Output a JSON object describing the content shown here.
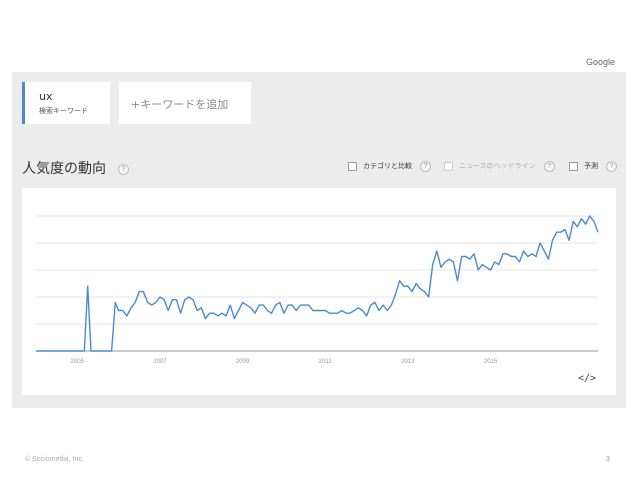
{
  "header": {
    "brand": "Google"
  },
  "keyword": {
    "term": "ux",
    "subtitle": "検索キーワード"
  },
  "add_keyword": {
    "label": "+キーワードを追加"
  },
  "section": {
    "title": "人気度の動向",
    "help": "?"
  },
  "options": [
    {
      "label": "カテゴリと比較",
      "enabled": true
    },
    {
      "label": "ニュースのヘッドライン",
      "enabled": false
    },
    {
      "label": "予測",
      "enabled": true
    }
  ],
  "chart_data": {
    "type": "line",
    "x_ticks": [
      "2005",
      "2007",
      "2009",
      "2011",
      "2013",
      "2015"
    ],
    "ylim": [
      0,
      100
    ],
    "grid": true,
    "color": "#4a8bd0",
    "series": [
      {
        "values": [
          [
            2004.0,
            0
          ],
          [
            2005.17,
            0
          ],
          [
            2005.25,
            24
          ],
          [
            2005.33,
            0
          ],
          [
            2005.83,
            0
          ],
          [
            2005.92,
            18
          ],
          [
            2006.0,
            15
          ],
          [
            2006.1,
            15
          ],
          [
            2006.2,
            13
          ],
          [
            2006.3,
            16
          ],
          [
            2006.4,
            18
          ],
          [
            2006.5,
            22
          ],
          [
            2006.6,
            22
          ],
          [
            2006.7,
            18
          ],
          [
            2006.8,
            17
          ],
          [
            2006.9,
            18
          ],
          [
            2007.0,
            20
          ],
          [
            2007.1,
            19
          ],
          [
            2007.2,
            15
          ],
          [
            2007.3,
            19
          ],
          [
            2007.4,
            19
          ],
          [
            2007.5,
            14
          ],
          [
            2007.6,
            19
          ],
          [
            2007.7,
            20
          ],
          [
            2007.8,
            19
          ],
          [
            2007.9,
            15
          ],
          [
            2008.0,
            16
          ],
          [
            2008.1,
            12
          ],
          [
            2008.2,
            14
          ],
          [
            2008.3,
            14
          ],
          [
            2008.4,
            13
          ],
          [
            2008.5,
            14
          ],
          [
            2008.6,
            13
          ],
          [
            2008.7,
            17
          ],
          [
            2008.8,
            12
          ],
          [
            2008.9,
            15
          ],
          [
            2009.0,
            18
          ],
          [
            2009.1,
            17
          ],
          [
            2009.2,
            16
          ],
          [
            2009.3,
            14
          ],
          [
            2009.4,
            17
          ],
          [
            2009.5,
            17
          ],
          [
            2009.6,
            15
          ],
          [
            2009.7,
            14
          ],
          [
            2009.8,
            17
          ],
          [
            2009.9,
            18
          ],
          [
            2010.0,
            14
          ],
          [
            2010.1,
            17
          ],
          [
            2010.2,
            17
          ],
          [
            2010.3,
            15
          ],
          [
            2010.4,
            17
          ],
          [
            2010.5,
            17
          ],
          [
            2010.6,
            17
          ],
          [
            2010.7,
            15
          ],
          [
            2010.8,
            15
          ],
          [
            2010.9,
            15
          ],
          [
            2011.0,
            15
          ],
          [
            2011.1,
            14
          ],
          [
            2011.2,
            14
          ],
          [
            2011.3,
            14
          ],
          [
            2011.4,
            15
          ],
          [
            2011.5,
            14
          ],
          [
            2011.6,
            14
          ],
          [
            2011.7,
            15
          ],
          [
            2011.8,
            16
          ],
          [
            2011.9,
            15
          ],
          [
            2012.0,
            13
          ],
          [
            2012.1,
            17
          ],
          [
            2012.2,
            18
          ],
          [
            2012.3,
            15
          ],
          [
            2012.4,
            17
          ],
          [
            2012.5,
            15
          ],
          [
            2012.6,
            17
          ],
          [
            2012.7,
            21
          ],
          [
            2012.8,
            26
          ],
          [
            2012.9,
            24
          ],
          [
            2013.0,
            24
          ],
          [
            2013.1,
            22
          ],
          [
            2013.2,
            25
          ],
          [
            2013.3,
            23
          ],
          [
            2013.4,
            22
          ],
          [
            2013.5,
            20
          ],
          [
            2013.6,
            32
          ],
          [
            2013.7,
            37
          ],
          [
            2013.8,
            31
          ],
          [
            2013.9,
            33
          ],
          [
            2014.0,
            34
          ],
          [
            2014.1,
            33
          ],
          [
            2014.2,
            26
          ],
          [
            2014.3,
            35
          ],
          [
            2014.4,
            35
          ],
          [
            2014.5,
            34
          ],
          [
            2014.6,
            36
          ],
          [
            2014.7,
            30
          ],
          [
            2014.8,
            32
          ],
          [
            2014.9,
            31
          ],
          [
            2015.0,
            30
          ],
          [
            2015.1,
            33
          ],
          [
            2015.2,
            32
          ],
          [
            2015.3,
            36
          ],
          [
            2015.4,
            36
          ],
          [
            2015.5,
            35
          ],
          [
            2015.6,
            35
          ],
          [
            2015.7,
            33
          ],
          [
            2015.8,
            37
          ],
          [
            2015.9,
            35
          ],
          [
            2016.0,
            36
          ],
          [
            2016.1,
            35
          ],
          [
            2016.2,
            40
          ],
          [
            2016.3,
            37
          ],
          [
            2016.4,
            34
          ],
          [
            2016.5,
            41
          ],
          [
            2016.6,
            44
          ],
          [
            2016.7,
            44
          ],
          [
            2016.8,
            45
          ],
          [
            2016.9,
            41
          ],
          [
            2017.0,
            48
          ],
          [
            2017.1,
            46
          ],
          [
            2017.2,
            49
          ],
          [
            2017.3,
            47
          ],
          [
            2017.4,
            50
          ],
          [
            2017.5,
            48
          ],
          [
            2017.6,
            44
          ]
        ]
      }
    ]
  },
  "embed": {
    "icon": "code-embed-icon",
    "symbol": "</>"
  },
  "footer": {
    "copyright": "© Sociomedia, Inc.",
    "page": "3"
  }
}
